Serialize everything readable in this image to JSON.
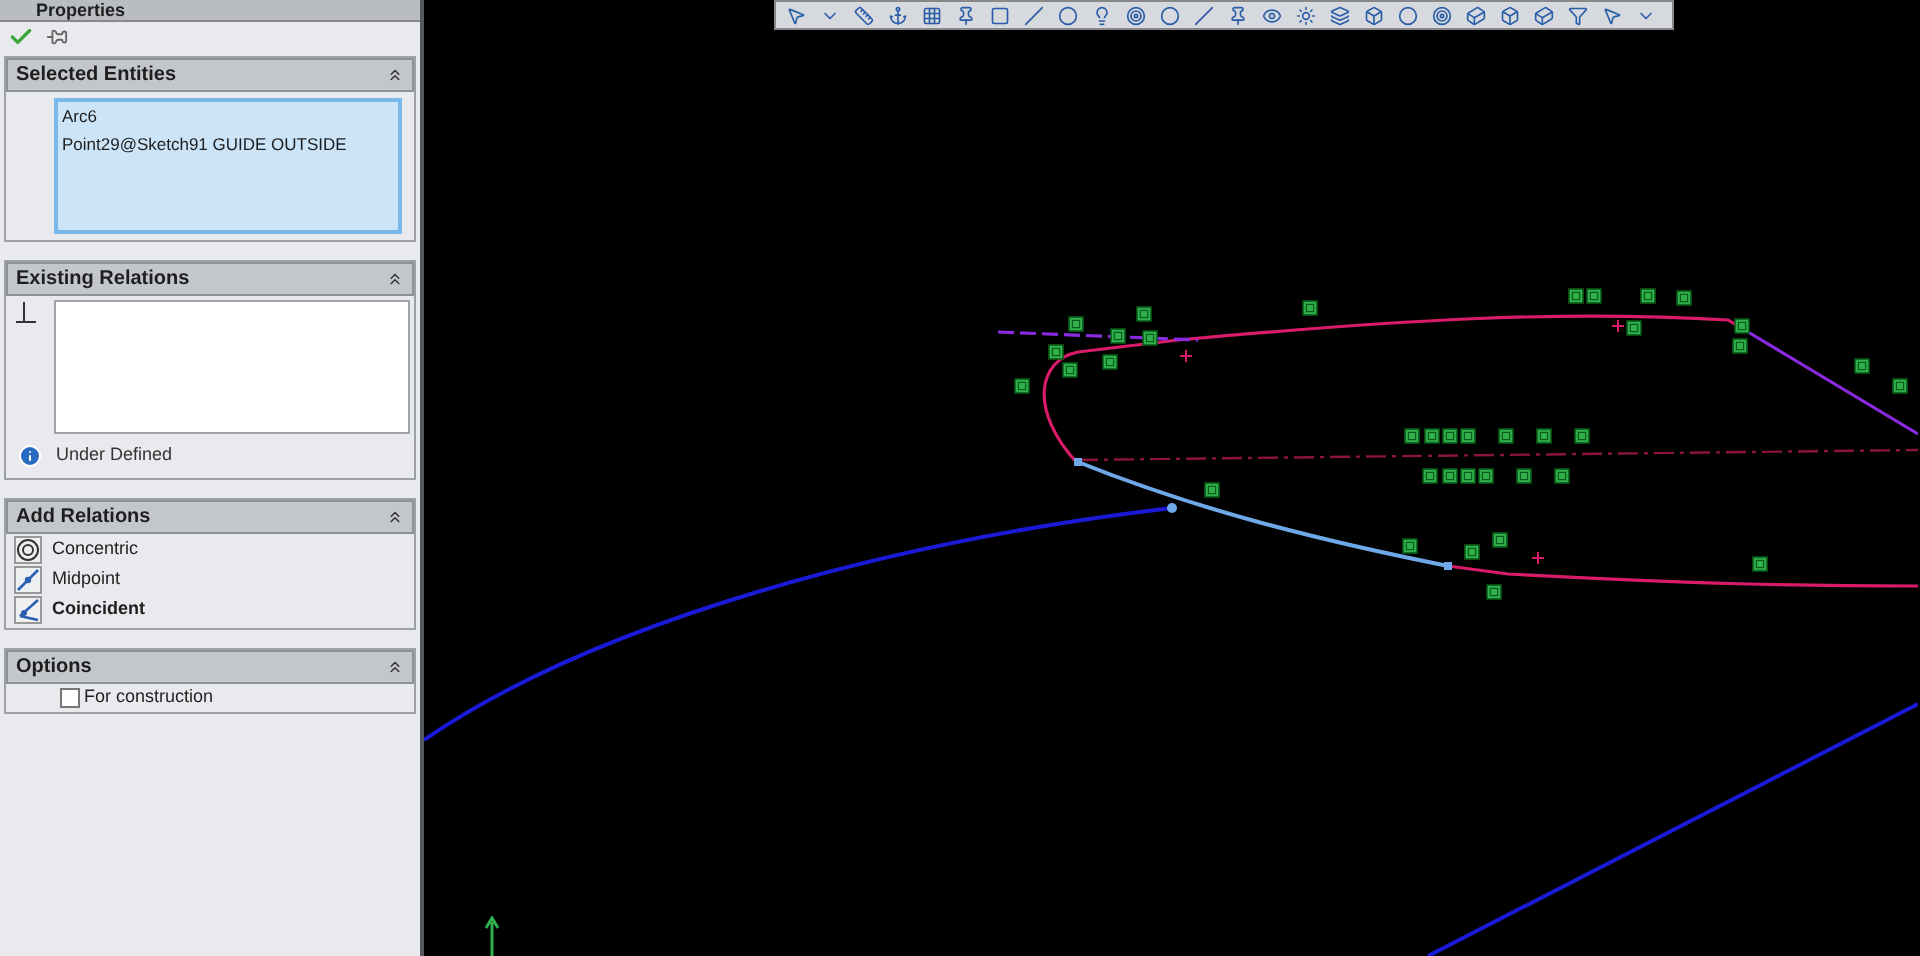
{
  "panel": {
    "title": "Properties",
    "sections": [
      {
        "kind": "selected_entities",
        "title": "Selected Entities",
        "entities": [
          "Arc6",
          "Point29@Sketch91 GUIDE OUTSIDE"
        ]
      },
      {
        "kind": "existing_relations",
        "title": "Existing Relations",
        "status": "Under Defined"
      },
      {
        "kind": "add_relations",
        "title": "Add Relations",
        "relations": [
          {
            "kind": "concentric",
            "label": "Concentric",
            "selected": false
          },
          {
            "kind": "midpoint",
            "label": "Midpoint",
            "selected": false
          },
          {
            "kind": "coincident",
            "label": "Coincident",
            "selected": true
          }
        ]
      },
      {
        "kind": "options",
        "title": "Options",
        "options": [
          {
            "label": "For construction",
            "checked": false
          }
        ]
      }
    ]
  }
}
